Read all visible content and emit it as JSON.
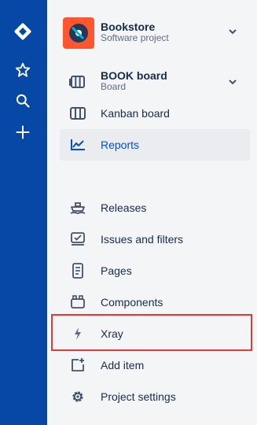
{
  "project": {
    "name": "Bookstore",
    "type": "Software project",
    "avatar_color": "#ff5630"
  },
  "board": {
    "name": "BOOK board",
    "subtitle": "Board"
  },
  "rail": {
    "icons": [
      "jira-logo-icon",
      "star-icon",
      "search-icon",
      "plus-icon"
    ],
    "color": "#0747a6"
  },
  "nav": {
    "kanban": "Kanban board",
    "reports": "Reports",
    "releases": "Releases",
    "issues": "Issues and filters",
    "pages": "Pages",
    "components": "Components",
    "xray": "Xray",
    "add_item": "Add item",
    "settings": "Project settings"
  },
  "colors": {
    "active_text": "#0052cc",
    "highlight_border": "#e53935"
  }
}
